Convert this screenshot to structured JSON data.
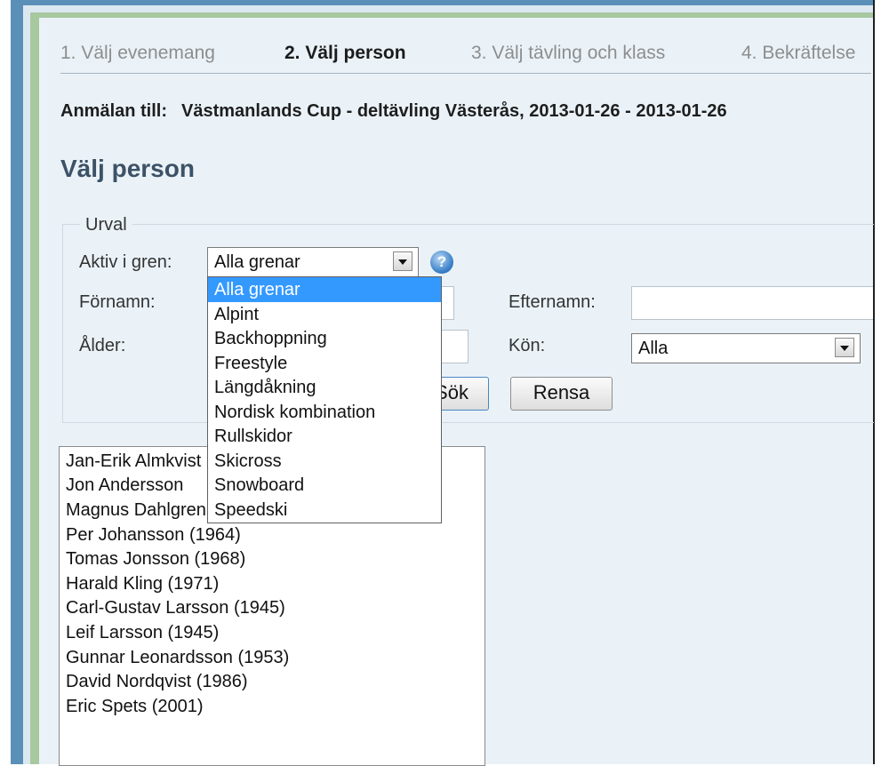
{
  "steps": [
    {
      "label": "1. Välj evenemang",
      "active": false
    },
    {
      "label": "2. Välj person",
      "active": true
    },
    {
      "label": "3. Välj tävling och klass",
      "active": false
    },
    {
      "label": "4. Bekräftelse",
      "active": false
    }
  ],
  "registration": {
    "label": "Anmälan till:",
    "event": "Västmanlands Cup - deltävling Västerås, 2013-01-26 - 2013-01-26"
  },
  "page_title": "Välj person",
  "filter": {
    "legend": "Urval",
    "branch_label": "Aktiv i gren:",
    "branch_value": "Alla grenar",
    "firstname_label": "Förnamn:",
    "lastname_label": "Efternamn:",
    "age_label": "Ålder:",
    "gender_label": "Kön:",
    "gender_value": "Alla",
    "search_button": "Sök",
    "clear_button": "Rensa",
    "help_symbol": "?"
  },
  "branch_options": [
    "Alla grenar",
    "Alpint",
    "Backhoppning",
    "Freestyle",
    "Längdåkning",
    "Nordisk kombination",
    "Rullskidor",
    "Skicross",
    "Snowboard",
    "Speedski"
  ],
  "selected_option_index": 0,
  "persons": [
    "Jan-Erik Almkvist",
    "Jon Andersson",
    "Magnus Dahlgren",
    "Per Johansson (1964)",
    "Tomas Jonsson (1968)",
    "Harald Kling (1971)",
    "Carl-Gustav Larsson (1945)",
    "Leif Larsson (1945)",
    "Gunnar Leonardsson (1953)",
    "David Nordqvist (1986)",
    "Eric Spets (2001)"
  ],
  "colors": {
    "frame_blue": "#5a8fb8",
    "content_bg": "#eaf2f8",
    "title_color": "#3d5266",
    "selection_blue": "#3399ff"
  }
}
